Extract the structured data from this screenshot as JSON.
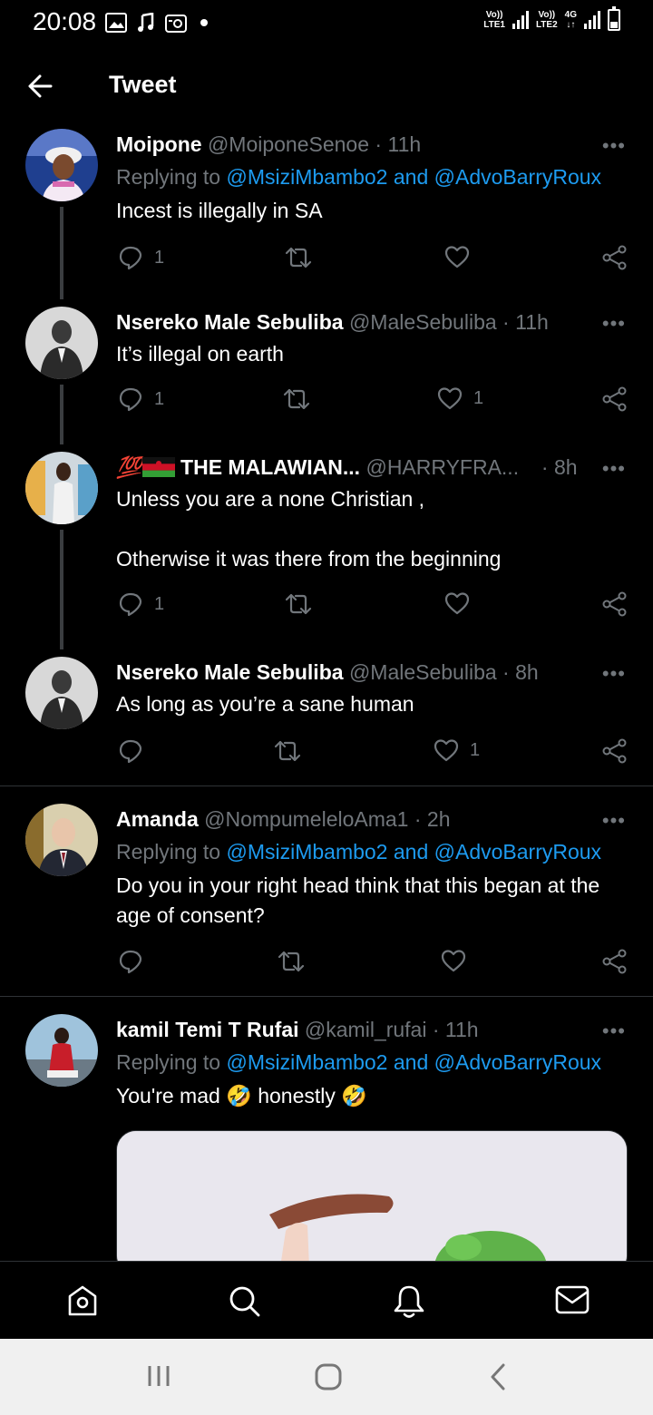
{
  "status_bar": {
    "time": "20:08",
    "sim1_label_top": "Vo))",
    "sim1_label_bottom": "LTE1",
    "sim2_label_top": "Vo))",
    "sim2_label_bottom": "LTE2",
    "network": "4G",
    "network_arrows": "↓↑",
    "battery_glyph": "7"
  },
  "header": {
    "title": "Tweet"
  },
  "tweets": [
    {
      "name": "Moipone",
      "handle": "@MoiponeSenoe",
      "time": "11h",
      "reply_prefix": "Replying to",
      "reply_mentions": "@MsiziMbambo2 and @AdvoBarryRoux",
      "text": "Incest is illegally in SA",
      "replies": "1",
      "retweets": "",
      "likes": ""
    },
    {
      "name": "Nsereko Male Sebuliba",
      "handle": "@MaleSebuliba",
      "time": "11h",
      "text": "It’s illegal on earth",
      "replies": "1",
      "retweets": "",
      "likes": "1"
    },
    {
      "name_prefix": "💯",
      "name": "THE MALAWIAN...",
      "handle": "@HARRYFRA...",
      "time": "8h",
      "text_line1": "Unless you are a none Christian ,",
      "text_line2": "Otherwise it was there from the beginning",
      "replies": "1",
      "retweets": "",
      "likes": ""
    },
    {
      "name": "Nsereko Male Sebuliba",
      "handle": "@MaleSebuliba",
      "time": "8h",
      "text": "As long as you’re a sane human",
      "replies": "",
      "retweets": "",
      "likes": "1"
    },
    {
      "name": "Amanda",
      "handle": "@NompumeleloAma1",
      "time": "2h",
      "reply_prefix": "Replying to",
      "reply_mentions": "@MsiziMbambo2 and @AdvoBarryRoux",
      "text": "Do you in your right head think that this began at the age of consent?",
      "replies": "",
      "retweets": "",
      "likes": ""
    },
    {
      "name": "kamil Temi T Rufai",
      "handle": "@kamil_rufai",
      "time": "11h",
      "reply_prefix": "Replying to",
      "reply_mentions": "@MsiziMbambo2 and @AdvoBarryRoux",
      "text_part1": "You're mad",
      "emoji": "🤣",
      "text_part2": "honestly"
    }
  ],
  "common": {
    "dot": "·",
    "more": "•••"
  },
  "colors": {
    "background": "#000000",
    "accent": "#1d9bf0",
    "muted": "#71767b",
    "text": "#ffffff"
  }
}
